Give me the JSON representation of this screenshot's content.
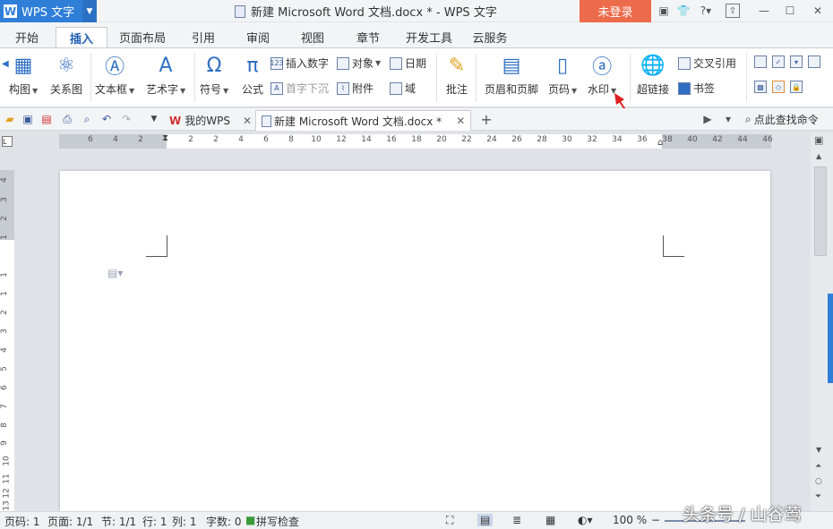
{
  "titlebar": {
    "app_name": "WPS 文字",
    "doc_title": "新建 Microsoft Word 文档.docx * - WPS 文字",
    "login_label": "未登录",
    "help_label": "?"
  },
  "menu_tabs": [
    "开始",
    "插入",
    "页面布局",
    "引用",
    "审阅",
    "视图",
    "章节",
    "开发工具",
    "云服务"
  ],
  "active_tab": "插入",
  "ribbon": {
    "left_group": {
      "chart": "构图",
      "relation": "关系图"
    },
    "textbox": "文本框",
    "arttext": "艺术字",
    "symbol": "符号",
    "formula": "公式",
    "insert_number": "插入数字",
    "drop_cap": "首字下沉",
    "object": "对象",
    "attachment": "附件",
    "date": "日期",
    "field": "域",
    "comment": "批注",
    "header_footer": "页眉和页脚",
    "page_number": "页码",
    "watermark": "水印",
    "hyperlink": "超链接",
    "cross_ref": "交叉引用",
    "bookmark": "书签"
  },
  "doc_tabs": {
    "home": "我的WPS",
    "current": "新建 Microsoft Word 文档.docx *",
    "add": "+",
    "search": "点此查找命令"
  },
  "ruler_h": [
    "6",
    "4",
    "2",
    "2",
    "2",
    "4",
    "6",
    "8",
    "10",
    "12",
    "14",
    "16",
    "18",
    "20",
    "22",
    "24",
    "26",
    "28",
    "30",
    "32",
    "34",
    "36",
    "38",
    "40",
    "42",
    "44",
    "46"
  ],
  "ruler_v": [
    "4",
    "3",
    "2",
    "1",
    "1",
    "1",
    "2",
    "3",
    "4",
    "5",
    "6",
    "7",
    "8",
    "9",
    "10",
    "11",
    "12",
    "13"
  ],
  "status": {
    "page": "页码: 1",
    "pages": "页面: 1/1",
    "section": "节: 1/1",
    "line": "行: 1",
    "col": "列: 1",
    "chars": "字数: 0",
    "spell": "拼写检查",
    "zoom": "100 %"
  },
  "overlay_watermark": "头条号 / 山谷莺",
  "colors": {
    "accent": "#2f7ed8",
    "login": "#ec6b4b",
    "arrow": "#e02020"
  }
}
